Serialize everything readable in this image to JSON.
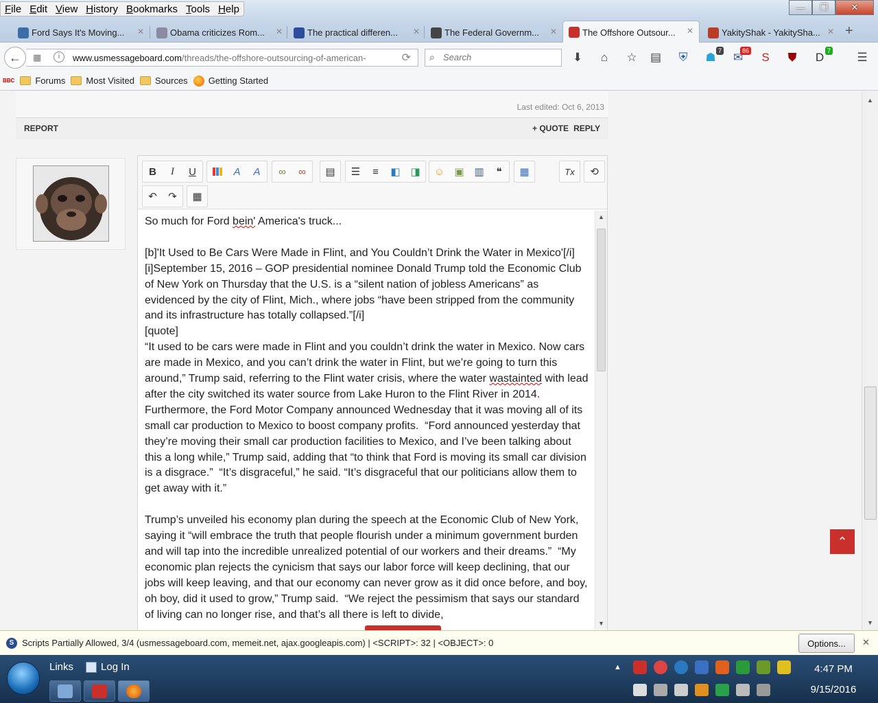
{
  "menu": [
    "File",
    "Edit",
    "View",
    "History",
    "Bookmarks",
    "Tools",
    "Help"
  ],
  "window_buttons": {
    "minimize": "—",
    "maximize": "❐",
    "close": "✕"
  },
  "tabs": [
    {
      "label": "Ford Says It's Moving...",
      "color": "#3b6ea8",
      "active": false
    },
    {
      "label": "Obama criticizes Rom...",
      "color": "#8a8aa0",
      "active": false
    },
    {
      "label": "The practical differen...",
      "color": "#2b4d9c",
      "active": false
    },
    {
      "label": "The Federal Governm...",
      "color": "#444444",
      "active": false
    },
    {
      "label": "The Offshore Outsour...",
      "color": "#c9302c",
      "active": true
    },
    {
      "label": "YakityShak - YakitySha...",
      "color": "#b73d26",
      "active": false
    }
  ],
  "nav": {
    "url_domain": "www.usmessageboard.com",
    "url_path": "/threads/the-offshore-outsourcing-of-american-",
    "search_placeholder": "Search",
    "badges": {
      "ghost": "7",
      "mail": "86",
      "dl": "7"
    }
  },
  "bookmarks": {
    "bbc": "BBC",
    "items": [
      "Forums",
      "Most Visited",
      "Sources",
      "Getting Started"
    ]
  },
  "post": {
    "last_edited": "Last edited: Oct 6, 2013",
    "report": "REPORT",
    "quote": "+ QUOTE",
    "reply": "REPLY"
  },
  "editor": {
    "toolbar_row1": [
      "B",
      "I",
      "U"
    ],
    "clear_format": "Tx",
    "lines": [
      "So much for Ford bein' America's truck...",
      "",
      "[b]'It Used to Be Cars Were Made in Flint, and You Couldn’t Drink the Water in Mexico'[/i]",
      "[i]September 15, 2016 – GOP presidential nominee Donald Trump told the Economic Club of New York on Thursday that the U.S. is a “silent nation of jobless Americans” as evidenced by the city of Flint, Mich., where jobs “have been stripped from the community and its infrastructure has totally collapsed.”[/i]",
      "[quote]",
      "“It used to be cars were made in Flint and you couldn’t drink the water in Mexico. Now cars are made in Mexico, and you can’t drink the water in Flint, but we’re going to turn this around,” Trump said, referring to the Flint water crisis, where the water wastainted with lead after the city switched its water source from Lake Huron to the Flint River in 2014.  Furthermore, the Ford Motor Company announced Wednesday that it was moving all of its small car production to Mexico to boost company profits.  “Ford announced yesterday that they’re moving their small car production facilities to Mexico, and I’ve been talking about this a long while,” Trump said, adding that “to think that Ford is moving its small car division is a disgrace.”  “It’s disgraceful,” he said. “It’s disgraceful that our politicians allow them to get away with it.”",
      "",
      "Trump’s unveiled his economy plan during the speech at the Economic Club of New York, saying it “will embrace the truth that people flourish under a minimum government burden and will tap into the incredible unrealized potential of our workers and their dreams.”  “My economic plan rejects the cynicism that says our labor force will keep declining, that our jobs will keep leaving, and that our economy can never grow as it did once before, and boy, oh boy, did it used to grow,” Trump said.  “We reject the pessimism that says our standard of living can no longer rise, and that’s all there is left to divide,"
    ]
  },
  "notification": {
    "text": "Scripts Partially Allowed, 3/4 (usmessageboard.com, memeit.net, ajax.googleapis.com) | <SCRIPT>: 32 | <OBJECT>: 0",
    "options": "Options...",
    "close": "✕"
  },
  "taskbar": {
    "links": "Links",
    "login": "Log In",
    "time": "4:47 PM",
    "date": "9/15/2016"
  },
  "colors": {
    "accent_red": "#c9302c",
    "taskbar": "#1f3d60"
  }
}
